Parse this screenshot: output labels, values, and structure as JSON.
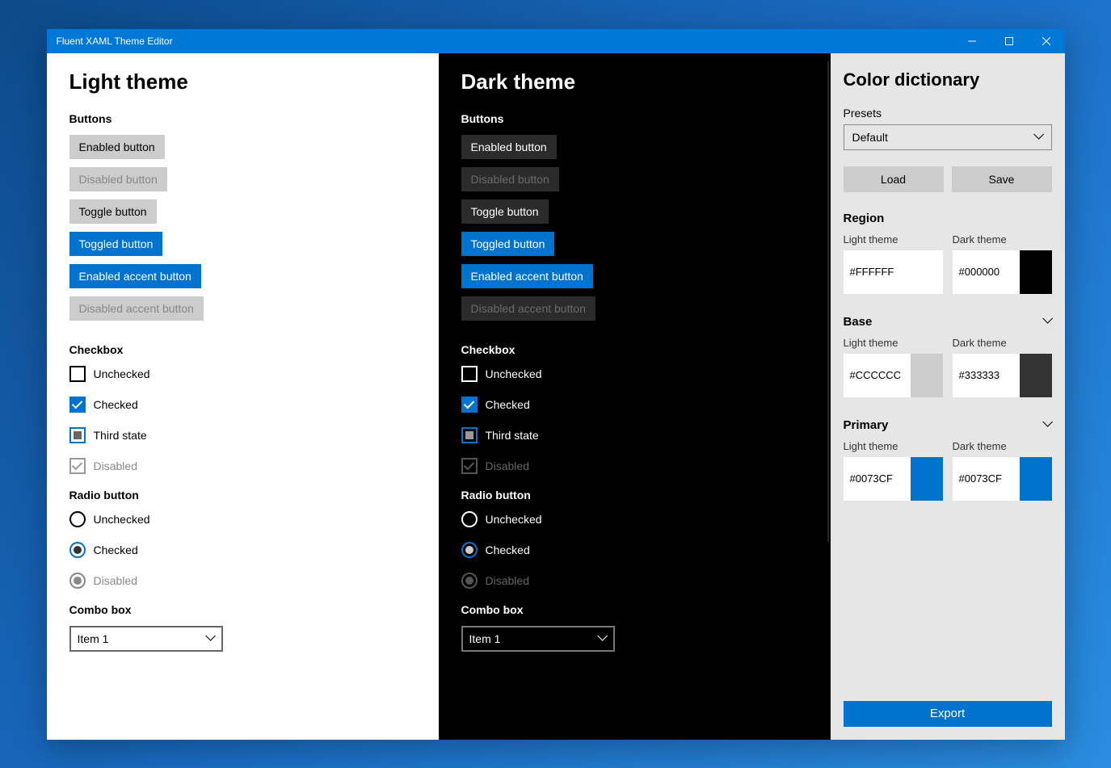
{
  "window": {
    "title": "Fluent XAML Theme Editor"
  },
  "preview": {
    "light_title": "Light theme",
    "dark_title": "Dark theme",
    "sections": {
      "buttons": "Buttons",
      "checkbox": "Checkbox",
      "radio": "Radio button",
      "combo": "Combo box"
    },
    "buttons": {
      "enabled": "Enabled button",
      "disabled": "Disabled button",
      "toggle": "Toggle button",
      "toggled": "Toggled button",
      "enabled_accent": "Enabled accent button",
      "disabled_accent": "Disabled accent button"
    },
    "checkbox": {
      "unchecked": "Unchecked",
      "checked": "Checked",
      "third": "Third state",
      "disabled": "Disabled"
    },
    "radio": {
      "unchecked": "Unchecked",
      "checked": "Checked",
      "disabled": "Disabled"
    },
    "combo": {
      "item1": "Item 1"
    }
  },
  "side": {
    "title": "Color dictionary",
    "presets_label": "Presets",
    "preset_value": "Default",
    "load": "Load",
    "save": "Save",
    "region": {
      "title": "Region",
      "light_label": "Light theme",
      "dark_label": "Dark theme",
      "light_hex": "#FFFFFF",
      "dark_hex": "#000000",
      "light_color": "#FFFFFF",
      "dark_color": "#000000"
    },
    "base": {
      "title": "Base",
      "light_label": "Light theme",
      "dark_label": "Dark theme",
      "light_hex": "#CCCCCC",
      "dark_hex": "#333333",
      "light_color": "#CCCCCC",
      "dark_color": "#333333"
    },
    "primary": {
      "title": "Primary",
      "light_label": "Light theme",
      "dark_label": "Dark theme",
      "light_hex": "#0073CF",
      "dark_hex": "#0073CF",
      "light_color": "#0073CF",
      "dark_color": "#0073CF"
    },
    "export": "Export"
  }
}
